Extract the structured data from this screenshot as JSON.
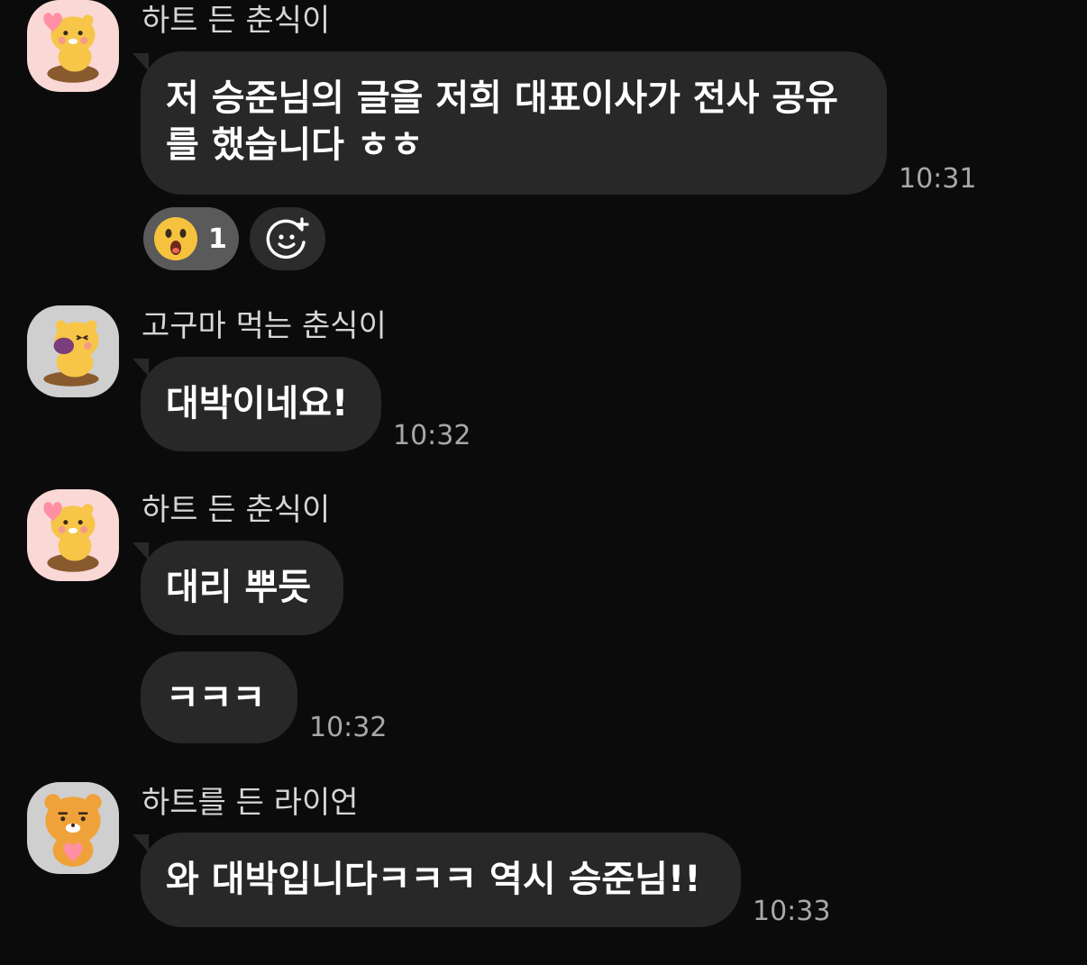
{
  "messages": [
    {
      "sender": "하트 든 춘식이",
      "avatar_icon": "heart-chunsik-avatar-icon",
      "bubbles": [
        {
          "lines": [
            "저 승준님의 글을 저희 대표이사가 전사 공유",
            "를 했습니다 ㅎㅎ"
          ]
        }
      ],
      "time": "10:31",
      "reactions": [
        {
          "emoji": "surprised-face-icon",
          "count": "1"
        }
      ],
      "add_reaction_icon": "add-emoji-icon"
    },
    {
      "sender": "고구마 먹는 춘식이",
      "avatar_icon": "sweet-potato-chunsik-avatar-icon",
      "bubbles": [
        {
          "lines": [
            "대박이네요!"
          ]
        }
      ],
      "time": "10:32"
    },
    {
      "sender": "하트 든 춘식이",
      "avatar_icon": "heart-chunsik-avatar-icon",
      "bubbles": [
        {
          "lines": [
            "대리 뿌듯"
          ]
        },
        {
          "lines": [
            "ㅋㅋㅋ"
          ]
        }
      ],
      "time": "10:32"
    },
    {
      "sender": "하트를 든 라이언",
      "avatar_icon": "heart-ryan-avatar-icon",
      "bubbles": [
        {
          "lines": [
            "와 대박입니다ㅋㅋㅋ 역시 승준님!!"
          ]
        }
      ],
      "time": "10:33"
    }
  ],
  "colors": {
    "background": "#0b0b0b",
    "bubble": "#282828",
    "sender_text": "#d6d6d6",
    "time_text": "#a8a8a8",
    "reaction_pill": "#5a5a5a"
  }
}
